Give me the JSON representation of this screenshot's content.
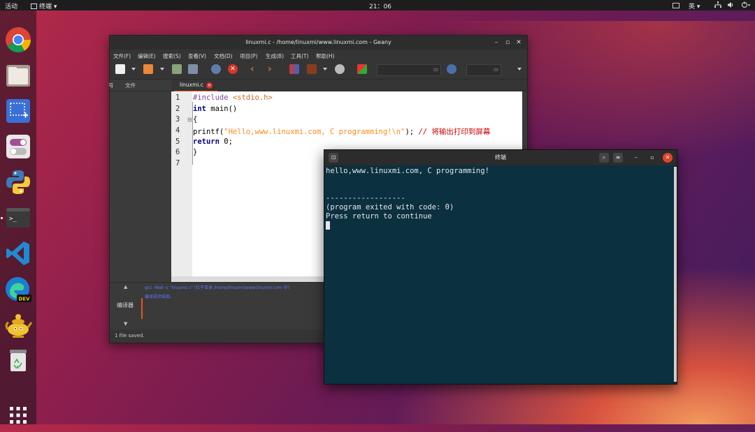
{
  "topbar": {
    "activities": "活动",
    "app_name": "终端",
    "clock": "21：06",
    "language": "英"
  },
  "dock": {
    "items": [
      "chrome-icon",
      "files-icon",
      "screenshot-icon",
      "tweaks-icon",
      "python-icon",
      "terminal-icon",
      "vscode-icon",
      "edge-dev-icon",
      "geany-icon",
      "trash-icon",
      "show-apps-icon"
    ],
    "edge_badge": "DEV",
    "terminal_glyph": ">_"
  },
  "geany": {
    "title": "linuxmi.c - /home/linuxmi/www.linuxmi.com - Geany",
    "menu": [
      "文件(F)",
      "编辑(E)",
      "搜索(S)",
      "查看(V)",
      "文档(D)",
      "项目(P)",
      "生成(B)",
      "工具(T)",
      "帮助(H)"
    ],
    "sidebar_tabs": [
      "号",
      "文件"
    ],
    "file_tab": "linuxmi.c",
    "line_numbers": [
      "1",
      "2",
      "3",
      "4",
      "5",
      "6",
      "7"
    ],
    "code": {
      "l1_pre": "#include",
      "l1_inc": "<stdio.h>",
      "l2_kw": "int",
      "l2_rest": " main()",
      "l3": "{",
      "l4_a": "printf(",
      "l4_str": "\"Hello,www.linuxmi.com, C programming!\\n\"",
      "l4_b": "); ",
      "l4_cmt": "// 将输出打印到屏幕",
      "l5_kw": "return",
      "l5_rest": " 0;",
      "l6": "}"
    },
    "msg_label": "编译器",
    "msg_line1": "gcc -Wall -c \"linuxmi.c\" (位于目录 /home/linuxmi/www.linuxmi.com 中)",
    "msg_line2": "编译成功结束。",
    "status": "1 file saved."
  },
  "terminal": {
    "title": "终端",
    "line1": "hello,www.linuxmi.com, C programming!",
    "line2": "",
    "line3": "",
    "line4": "------------------",
    "line5": "(program exited with code: 0)",
    "line6": "Press return to continue"
  },
  "colors": {
    "accent": "#e95420",
    "terminal_bg": "#0b3040",
    "close_red": "#e0452b"
  }
}
